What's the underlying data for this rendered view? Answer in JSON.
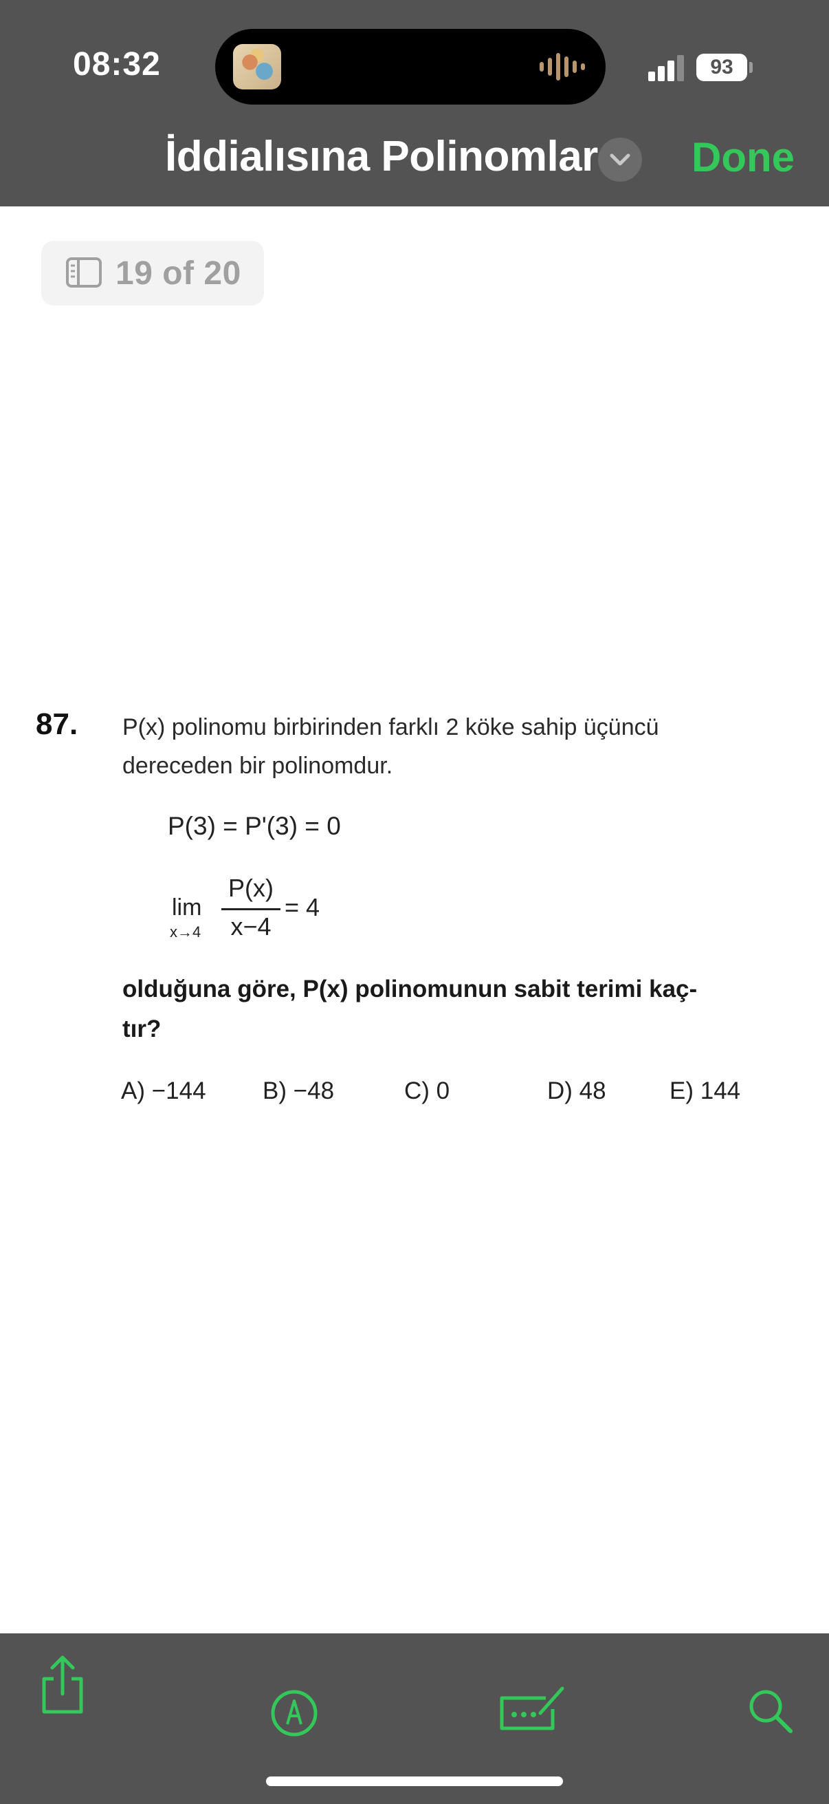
{
  "status_bar": {
    "time": "08:32",
    "battery": "93",
    "signal_icon": "cellular-signal-icon"
  },
  "nav": {
    "title": "İddialısına Polinomlar",
    "done_label": "Done",
    "chevron_icon": "chevron-down-icon"
  },
  "page_indicator": {
    "icon": "sidebar-icon",
    "label": "19 of 20"
  },
  "document": {
    "question_number": "87.",
    "line1": "P(x)  polinomu birbirinden farklı  2  köke sahip üçüncü",
    "line2": "dereceden bir polinomdur.",
    "equation1": "P(3) = P'(3) = 0",
    "limit_word": "lim",
    "limit_sub": "x→4",
    "fraction_numerator": "P(x)",
    "fraction_denominator": "x−4",
    "fraction_result": "= 4",
    "prompt_line1": "olduğuna göre,  P(x)  polinomunun sabit terimi kaç-",
    "prompt_line2": "tır?",
    "options": [
      "A) −144",
      "B) −48",
      "C) 0",
      "D) 48",
      "E) 144"
    ]
  },
  "toolbar": {
    "share_icon": "share-icon",
    "markup_icon": "markup-pen-icon",
    "form_icon": "fill-sign-icon",
    "search_icon": "search-icon"
  },
  "colors": {
    "bar_background": "#535353",
    "accent": "#34c759"
  }
}
